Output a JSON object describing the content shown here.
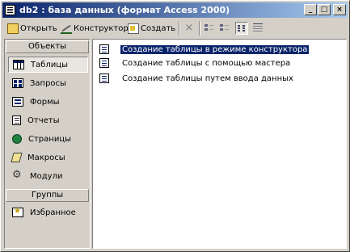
{
  "window": {
    "title": "db2 : база данных (формат Access 2000)",
    "controls": {
      "minimize": "_",
      "maximize": "□",
      "close": "×"
    }
  },
  "toolbar": {
    "open_label": "Открыть",
    "design_label": "Конструктор",
    "new_label": "Создать",
    "delete_icon": "×",
    "view_buttons": [
      "large-icons",
      "small-icons",
      "list",
      "details"
    ],
    "active_view": "list"
  },
  "sidebar": {
    "objects_header": "Объекты",
    "items": [
      {
        "label": "Таблицы",
        "icon": "table-icon",
        "selected": true
      },
      {
        "label": "Запросы",
        "icon": "query-icon"
      },
      {
        "label": "Формы",
        "icon": "form-icon"
      },
      {
        "label": "Отчеты",
        "icon": "report-icon"
      },
      {
        "label": "Страницы",
        "icon": "page-icon"
      },
      {
        "label": "Макросы",
        "icon": "macro-icon"
      },
      {
        "label": "Модули",
        "icon": "module-icon"
      }
    ],
    "groups_header": "Группы",
    "groups": [
      {
        "label": "Избранное",
        "icon": "favorites-icon"
      }
    ]
  },
  "main": {
    "items": [
      {
        "label": "Создание таблицы в режиме конструктора",
        "selected": true
      },
      {
        "label": "Создание таблицы с помощью мастера"
      },
      {
        "label": "Создание таблицы путем ввода данных"
      }
    ]
  },
  "colors": {
    "title_start": "#0a246a",
    "title_end": "#a6caf0",
    "face": "#d4d0c8",
    "selection": "#0a246a"
  }
}
